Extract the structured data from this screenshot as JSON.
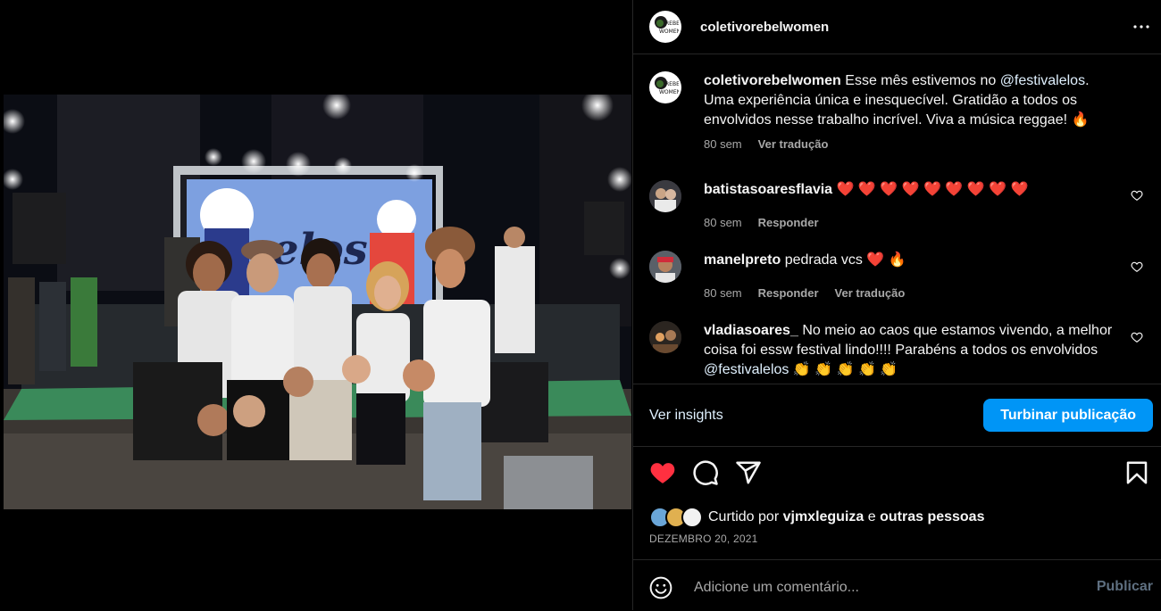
{
  "post": {
    "username": "coletivorebelwomen",
    "more_icon": "more-horizontal-icon"
  },
  "caption": {
    "user": "coletivorebelwomen",
    "text_before": "Esse mês estivemos no ",
    "mention": "@festivalelos",
    "text_after": ". Uma experiência única e inesquecível. Gratidão a todos os envolvidos nesse trabalho incrível. Viva a música reggae! 🔥",
    "time": "80 sem",
    "translate": "Ver tradução"
  },
  "comments": [
    {
      "user": "batistasoaresflavia",
      "text": "❤️ ❤️ ❤️ ❤️ ❤️ ❤️ ❤️ ❤️ ❤️",
      "time": "80 sem",
      "reply": "Responder",
      "translate": ""
    },
    {
      "user": "manelpreto",
      "text": "pedrada vcs ❤️ 🔥",
      "time": "80 sem",
      "reply": "Responder",
      "translate": "Ver tradução"
    },
    {
      "user": "vladiasoares_",
      "text_before": "No meio ao caos que estamos vivendo, a melhor coisa foi essw festival lindo!!!! Parabéns a todos os envolvidos ",
      "mention": "@festivalelos",
      "text_after": " 👏 👏 👏 👏 👏"
    }
  ],
  "insights": {
    "label": "Ver insights"
  },
  "boost": {
    "label": "Turbinar publicação"
  },
  "likes": {
    "prefix": "Curtido por ",
    "user": "vjmxleguiza",
    "middle": " e ",
    "rest": "outras pessoas"
  },
  "date": "DEZEMBRO 20, 2021",
  "add_comment": {
    "placeholder": "Adicione um comentário...",
    "post_label": "Publicar"
  },
  "colors": {
    "accent": "#0095f6",
    "like": "#ff3040",
    "link": "#e0f1ff"
  }
}
